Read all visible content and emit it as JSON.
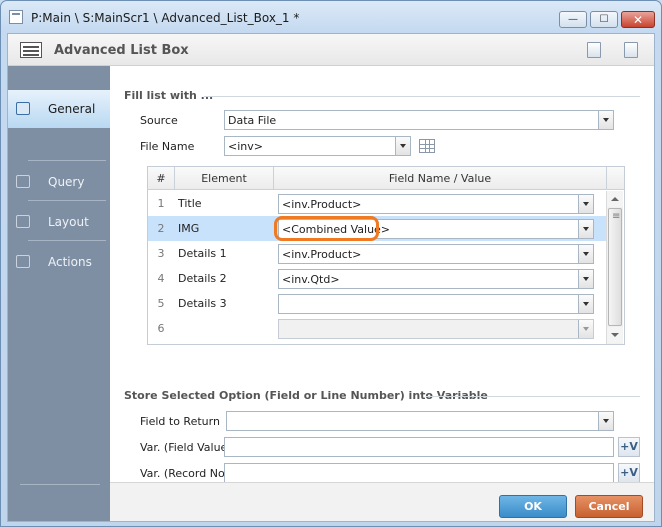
{
  "window": {
    "title": "P:Main \\ S:MainScr1 \\ Advanced_List_Box_1 *",
    "min_glyph": "—",
    "max_glyph": "☐",
    "close_glyph": "✕"
  },
  "header": {
    "title": "Advanced List Box",
    "icons": [
      "save-icon",
      "document-icon"
    ]
  },
  "sidebar": {
    "items": [
      {
        "label": "General",
        "icon": "edit-icon",
        "active": true
      },
      {
        "label": "Query",
        "icon": "query-icon",
        "active": false
      },
      {
        "label": "Layout",
        "icon": "layout-icon",
        "active": false
      },
      {
        "label": "Actions",
        "icon": "actions-icon",
        "active": false
      }
    ]
  },
  "fill_section": {
    "title": "Fill list with ...",
    "source_label": "Source",
    "source_value": "Data File",
    "file_name_label": "File Name",
    "file_name_value": "<inv>"
  },
  "table": {
    "headers": [
      "#",
      "Element",
      "Field Name / Value"
    ],
    "rows": [
      {
        "num": "1",
        "element": "Title",
        "value": "<inv.Product>",
        "selected": false,
        "disabled": false
      },
      {
        "num": "2",
        "element": "IMG",
        "value": "<Combined Value>",
        "selected": true,
        "disabled": false
      },
      {
        "num": "3",
        "element": "Details 1",
        "value": "<inv.Product>",
        "selected": false,
        "disabled": false
      },
      {
        "num": "4",
        "element": "Details 2",
        "value": "<inv.Qtd>",
        "selected": false,
        "disabled": false
      },
      {
        "num": "5",
        "element": "Details 3",
        "value": "",
        "selected": false,
        "disabled": false
      },
      {
        "num": "6",
        "element": "",
        "value": "",
        "selected": false,
        "disabled": true
      }
    ]
  },
  "store_section": {
    "title": "Store Selected Option (Field or Line Number) into Variable",
    "field_to_return_label": "Field to Return",
    "field_to_return_value": "",
    "var_field_label": "Var. (Field Value)",
    "var_field_value": "",
    "var_record_label": "Var. (Record No)",
    "var_record_value": "",
    "var_button_glyph": "+V"
  },
  "footer": {
    "ok_label": "OK",
    "cancel_label": "Cancel"
  },
  "colors": {
    "accent": "#3a8cc9",
    "cancel": "#c8602f",
    "highlight_ring": "#f07a22",
    "selected_row": "#c9e2fb",
    "sidebar": "#7f8fa3"
  }
}
